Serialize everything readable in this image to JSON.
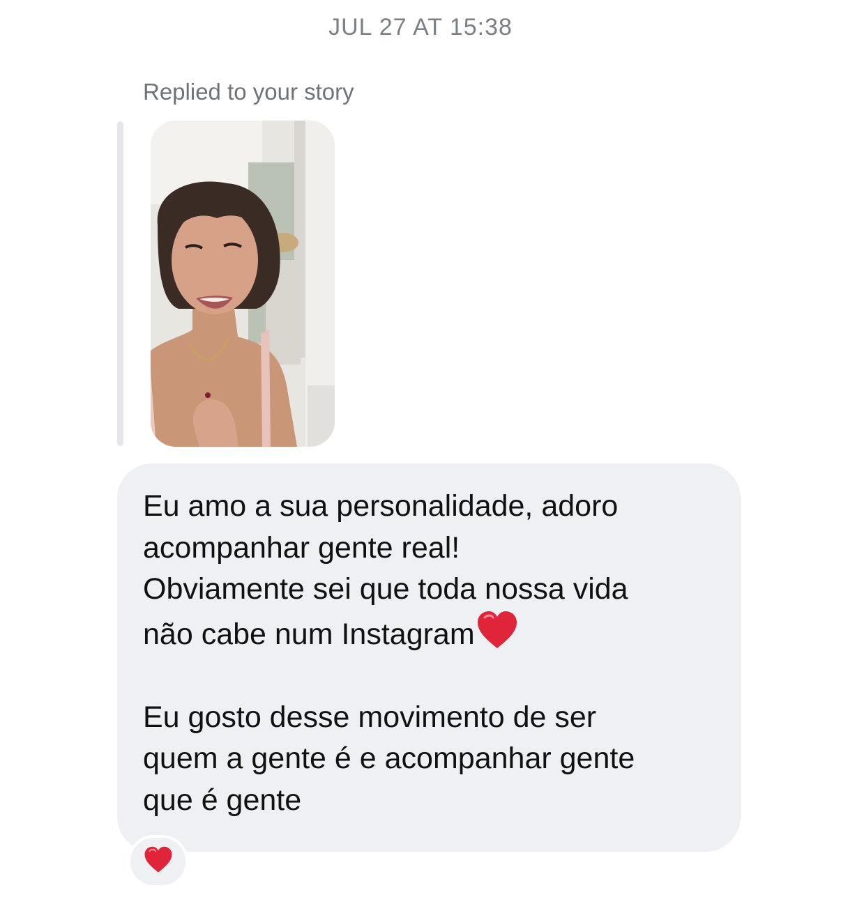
{
  "thread": {
    "timestamp": "JUL 27 AT 15:38",
    "reply_label": "Replied to your story"
  },
  "message": {
    "lines": [
      "Eu amo a sua personalidade, adoro",
      "acompanhar gente real!",
      "Obviamente sei que toda nossa vida",
      "não cabe num Instagram",
      "",
      "Eu gosto desse movimento de ser",
      "quem a gente é e acompanhar  gente",
      "que é gente"
    ],
    "inline_emoji": "red-heart-icon"
  },
  "reaction": {
    "emoji": "red-heart-icon"
  },
  "colors": {
    "bubble": "#eff0f3",
    "timestamp": "#7b7f86",
    "heart": "#e0243a"
  }
}
